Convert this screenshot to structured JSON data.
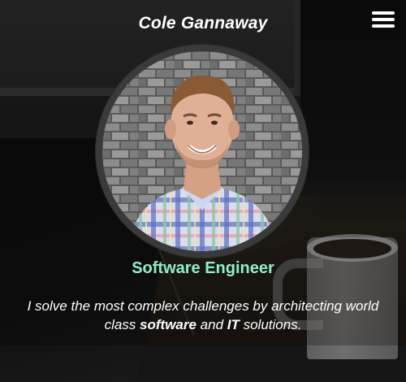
{
  "header": {
    "name": "Cole Gannaway",
    "menu_icon": "hamburger-menu-icon"
  },
  "profile": {
    "photo_alt": "Profile photo",
    "title": "Software Engineer",
    "title_color": "#8ef0c8"
  },
  "tagline": {
    "line1": "I solve the most complex challenges by architecting world",
    "line2_prefix": "class ",
    "highlight1": "software",
    "middle": " and ",
    "highlight2": "IT",
    "suffix": " solutions."
  }
}
